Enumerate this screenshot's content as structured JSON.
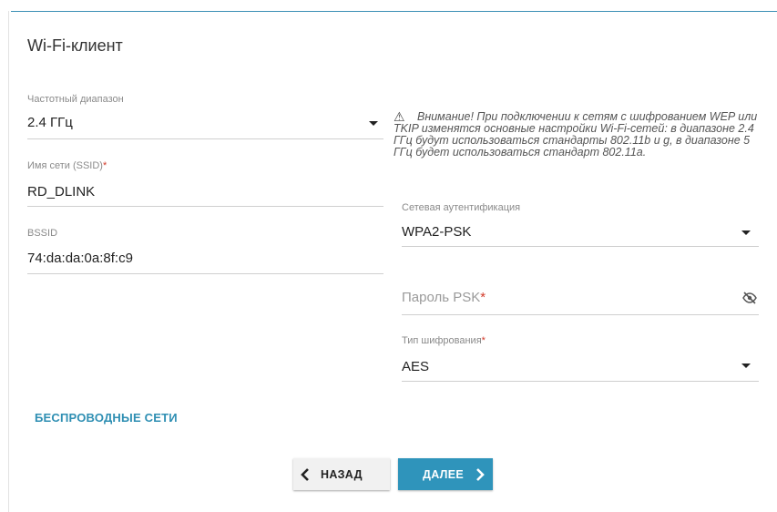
{
  "page": {
    "title": "Wi-Fi-клиент"
  },
  "left": {
    "band": {
      "label": "Частотный диапазон",
      "value": "2.4 ГГц"
    },
    "ssid": {
      "label": "Имя сети (SSID)",
      "required": "*",
      "value": "RD_DLINK"
    },
    "bssid": {
      "label": "BSSID",
      "value": "74:da:da:0a:8f:c9"
    }
  },
  "warning": {
    "icon": "warning-triangle-icon",
    "text": "Внимание! При подключении к сетям с шифрованием WEP или TKIP изменятся основные настройки Wi-Fi-сетей: в диапазоне 2.4 ГГц будут использоваться стандарты 802.11b и g, в диапазоне 5 ГГц будет использоваться стандарт 802.11a."
  },
  "right": {
    "auth": {
      "label": "Сетевая аутентификация",
      "value": "WPA2-PSK"
    },
    "psk": {
      "placeholder": "Пароль PSK",
      "required": "*",
      "icon": "eye-off-icon"
    },
    "cipher": {
      "label": "Тип шифрования",
      "required": "*",
      "value": "AES"
    }
  },
  "links": {
    "wireless": "БЕСПРОВОДНЫЕ СЕТИ"
  },
  "buttons": {
    "back": "НАЗАД",
    "next": "ДАЛЕЕ"
  },
  "colors": {
    "accent": "#2f94bb",
    "link": "#2f8fb3",
    "required": "#d23b2a"
  }
}
